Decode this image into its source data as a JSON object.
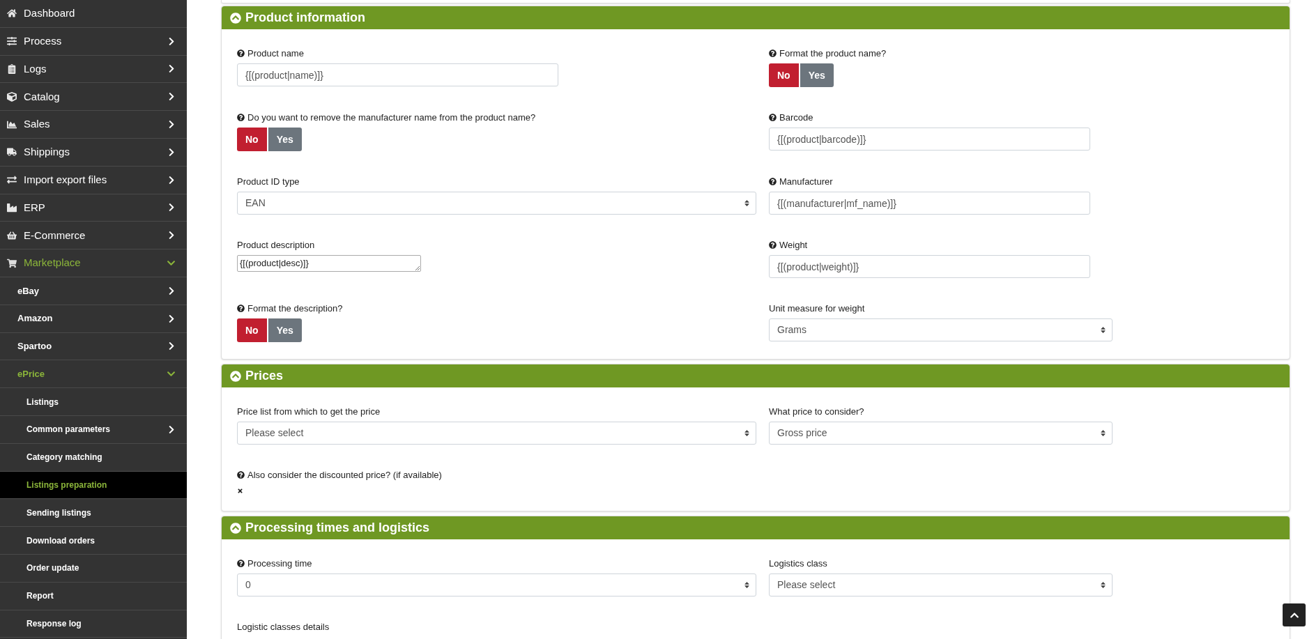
{
  "sidebar": {
    "items": [
      {
        "label": "Dashboard",
        "selected": false
      },
      {
        "label": "Process",
        "selected": false,
        "expanded": false
      },
      {
        "label": "Logs",
        "selected": false,
        "expanded": false
      },
      {
        "label": "Catalog",
        "selected": false,
        "expanded": false
      },
      {
        "label": "Sales",
        "selected": false,
        "expanded": false
      },
      {
        "label": "Shippings",
        "selected": false,
        "expanded": false
      },
      {
        "label": "Import export files",
        "selected": false,
        "expanded": false
      },
      {
        "label": "ERP",
        "selected": false,
        "expanded": false
      },
      {
        "label": "E-Commerce",
        "selected": false,
        "expanded": false
      },
      {
        "label": "Marketplace",
        "selected": false,
        "expanded": true,
        "children": [
          {
            "label": "eBay",
            "selected": false,
            "expanded": false
          },
          {
            "label": "Amazon",
            "selected": false,
            "expanded": false
          },
          {
            "label": "Spartoo",
            "selected": false,
            "expanded": false
          },
          {
            "label": "ePrice",
            "selected": false,
            "expanded": true,
            "children": [
              {
                "label": "Listings",
                "selected": false
              },
              {
                "label": "Common parameters",
                "selected": false,
                "expanded": false
              },
              {
                "label": "Category matching",
                "selected": false
              },
              {
                "label": "Listings preparation",
                "selected": true
              },
              {
                "label": "Sending listings",
                "selected": false
              },
              {
                "label": "Download orders",
                "selected": false
              },
              {
                "label": "Order update",
                "selected": false
              },
              {
                "label": "Report",
                "selected": false
              },
              {
                "label": "Response log",
                "selected": false
              }
            ]
          }
        ]
      }
    ]
  },
  "sections": [
    {
      "title": "Product information",
      "expanded": true,
      "rows": [
        [
          {
            "kind": "text",
            "label": "Product name",
            "help": true,
            "value": "{[(product|name)]}"
          },
          {
            "kind": "toggle",
            "label": "Format the product name?",
            "help": true,
            "options": [
              {
                "label": "No",
                "selected": true
              },
              {
                "label": "Yes",
                "selected": false
              }
            ]
          }
        ],
        [
          {
            "kind": "toggle",
            "label": "Do you want to remove the manufacturer name from the product name?",
            "help": true,
            "options": [
              {
                "label": "No",
                "selected": true
              },
              {
                "label": "Yes",
                "selected": false
              }
            ]
          },
          {
            "kind": "text",
            "label": "Barcode",
            "help": true,
            "value": "{[(product|barcode)]}"
          }
        ],
        [
          {
            "kind": "select",
            "label": "Product ID type",
            "help": false,
            "value": "EAN"
          },
          {
            "kind": "text",
            "label": "Manufacturer",
            "help": true,
            "value": "{[(manufacturer|mf_name)]}"
          }
        ],
        [
          {
            "kind": "textarea",
            "label": "Product description",
            "help": false,
            "value": "{[(product|desc)]}"
          },
          {
            "kind": "text",
            "label": "Weight",
            "help": true,
            "value": "{[(product|weight)]}"
          }
        ],
        [
          {
            "kind": "toggle",
            "label": "Format the description?",
            "help": true,
            "options": [
              {
                "label": "No",
                "selected": true
              },
              {
                "label": "Yes",
                "selected": false
              }
            ]
          },
          {
            "kind": "select",
            "label": "Unit measure for weight",
            "help": false,
            "value": "Grams"
          }
        ]
      ]
    },
    {
      "title": "Prices",
      "expanded": true,
      "rows": [
        [
          {
            "kind": "select",
            "label": "Price list from which to get the price",
            "help": false,
            "value": "Please select"
          },
          {
            "kind": "select",
            "label": "What price to consider?",
            "help": false,
            "value": "Gross price"
          }
        ],
        [
          {
            "kind": "flag",
            "label": "Also consider the discounted price? (if available)",
            "help": true,
            "checked": false
          }
        ]
      ]
    },
    {
      "title": "Processing times and logistics",
      "expanded": true,
      "rows": [
        [
          {
            "kind": "select",
            "label": "Processing time",
            "help": true,
            "value": "0"
          },
          {
            "kind": "select",
            "label": "Logistics class",
            "help": false,
            "value": "Please select"
          }
        ],
        [
          {
            "kind": "label",
            "label": "Logistic classes details",
            "help": false
          }
        ]
      ]
    }
  ]
}
